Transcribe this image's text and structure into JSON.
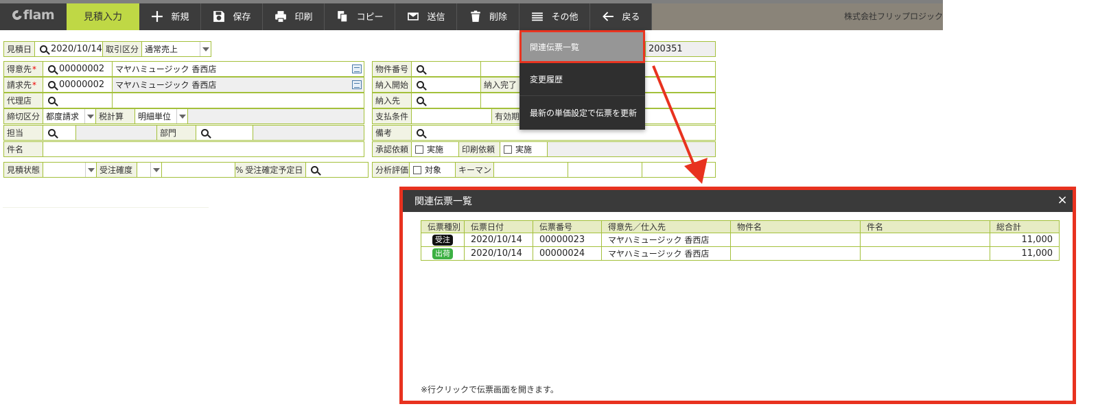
{
  "toolbar": {
    "logo": "flam",
    "items": [
      {
        "label": "見積入力",
        "icon": "none"
      },
      {
        "label": "新規",
        "icon": "plus-icon"
      },
      {
        "label": "保存",
        "icon": "floppy-disk-icon"
      },
      {
        "label": "印刷",
        "icon": "printer-icon"
      },
      {
        "label": "コピー",
        "icon": "copy-icon"
      },
      {
        "label": "送信",
        "icon": "envelope-icon"
      },
      {
        "label": "削除",
        "icon": "trash-icon"
      },
      {
        "label": "その他",
        "icon": "menu-lines-icon"
      },
      {
        "label": "戻る",
        "icon": "arrow-left-icon"
      }
    ],
    "company": "株式会社フリップロジック"
  },
  "form": {
    "quote_date_label": "見積日",
    "quote_date": "2020/10/14",
    "txn_type_label": "取引区分",
    "txn_type": "通常売上",
    "doc_number": "200351",
    "customer_label": "得意先",
    "customer_code": "00000002",
    "customer_name": "マヤハミュージック 香西店",
    "billing_label": "請求先",
    "billing_code": "00000002",
    "billing_name": "マヤハミュージック 香西店",
    "agent_label": "代理店",
    "closing_label": "締切区分",
    "closing_value": "都度請求",
    "tax_label": "税計算",
    "tax_value": "明細単位",
    "staff_label": "担当",
    "dept_label": "部門",
    "subject_label": "件名",
    "property_label": "物件番号",
    "delivery_start_label": "納入開始",
    "delivery_end_label": "納入完了",
    "delivery_to_label": "納入先",
    "payment_label": "支払条件",
    "validity_label": "有効期",
    "remarks_label": "備考",
    "approval_label": "承認依頼",
    "approval_check": "実施",
    "print_req_label": "印刷依頼",
    "print_req_check": "実施",
    "quote_state_label": "見積状態",
    "order_prob_label": "受注確度",
    "percent": "%",
    "order_date_label": "受注確定予定日",
    "analysis_label": "分析評価",
    "analysis_check": "対象",
    "keyman_label": "キーマン"
  },
  "menu": {
    "items": [
      "関連伝票一覧",
      "変更履歴",
      "最新の単価設定で伝票を更新"
    ],
    "active_index": 0
  },
  "modal": {
    "title": "関連伝票一覧",
    "close": "×",
    "columns": [
      "伝票種別",
      "伝票日付",
      "伝票番号",
      "得意先／仕入先",
      "物件名",
      "件名",
      "総合計"
    ],
    "rows": [
      {
        "type": "受注",
        "type_color": "#111111",
        "date": "2020/10/14",
        "number": "00000023",
        "partner": "マヤハミュージック 香西店",
        "property": "",
        "subject": "",
        "total": "11,000"
      },
      {
        "type": "出荷",
        "type_color": "#3cb043",
        "date": "2020/10/14",
        "number": "00000024",
        "partner": "マヤハミュージック 香西店",
        "property": "",
        "subject": "",
        "total": "11,000"
      }
    ],
    "note": "※行クリックで伝票画面を開きます。"
  },
  "colors": {
    "accent_green": "#bfd845",
    "highlight_red": "#e8321f",
    "border_green": "#a3c03a"
  }
}
